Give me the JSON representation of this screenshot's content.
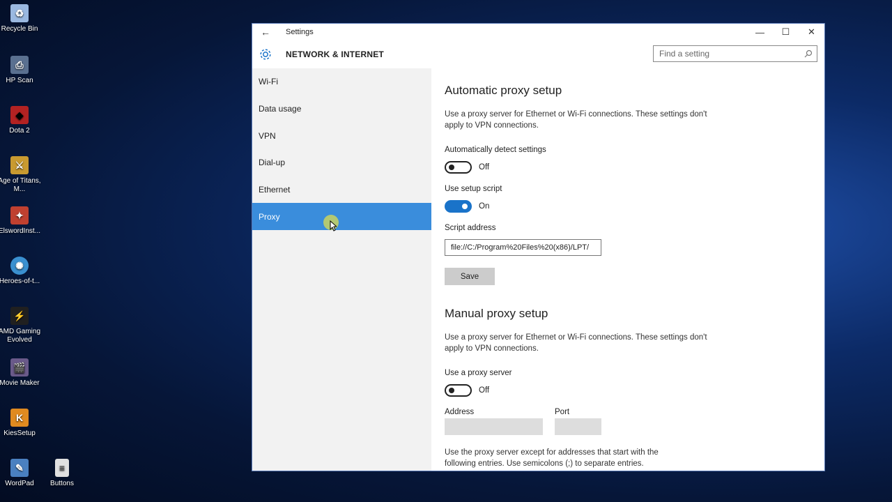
{
  "desktop": {
    "icons": [
      {
        "label": "Recycle Bin",
        "icon": "recycle-bin-icon",
        "color": "#9ab8e0"
      },
      {
        "label": "HP Scan",
        "icon": "hp-scan-icon",
        "color": "#5a7090"
      },
      {
        "label": "Dota 2",
        "icon": "dota2-icon",
        "color": "#b22222"
      },
      {
        "label": "Age of Titans, M...",
        "icon": "age-of-titans-icon",
        "color": "#c89a30"
      },
      {
        "label": "ElswordInst...",
        "icon": "elsword-icon",
        "color": "#c04030"
      },
      {
        "label": "Heroes-of-t...",
        "icon": "heroes-icon",
        "color": "#3a90d0"
      },
      {
        "label": "AMD Gaming Evolved",
        "icon": "amd-gaming-icon",
        "color": "#202020"
      },
      {
        "label": "Movie Maker",
        "icon": "movie-maker-icon",
        "color": "#6a5a8a"
      },
      {
        "label": "KiesSetup",
        "icon": "kies-icon",
        "color": "#e08a20"
      },
      {
        "label": "WordPad",
        "icon": "wordpad-icon",
        "color": "#4a80c0"
      },
      {
        "label": "Buttons",
        "icon": "file-icon",
        "color": "#e0e0e0"
      }
    ]
  },
  "window": {
    "title": "Settings",
    "section": "NETWORK & INTERNET",
    "search_placeholder": "Find a setting"
  },
  "sidebar": {
    "items": [
      {
        "label": "Wi-Fi"
      },
      {
        "label": "Data usage"
      },
      {
        "label": "VPN"
      },
      {
        "label": "Dial-up"
      },
      {
        "label": "Ethernet"
      },
      {
        "label": "Proxy",
        "active": true
      }
    ]
  },
  "auto_proxy": {
    "heading": "Automatic proxy setup",
    "description": "Use a proxy server for Ethernet or Wi-Fi connections. These settings don't apply to VPN connections.",
    "detect_label": "Automatically detect settings",
    "detect_state": "Off",
    "script_label": "Use setup script",
    "script_state": "On",
    "address_label": "Script address",
    "address_value": "file://C:/Program%20Files%20(x86)/LPT/",
    "save_label": "Save"
  },
  "manual_proxy": {
    "heading": "Manual proxy setup",
    "description": "Use a proxy server for Ethernet or Wi-Fi connections. These settings don't apply to VPN connections.",
    "use_label": "Use a proxy server",
    "use_state": "Off",
    "address_label": "Address",
    "port_label": "Port",
    "exceptions_text": "Use the proxy server except for addresses that start with the following entries. Use semicolons (;) to separate entries."
  },
  "colors": {
    "accent": "#1a73c9",
    "selection": "#3a8ddc"
  }
}
